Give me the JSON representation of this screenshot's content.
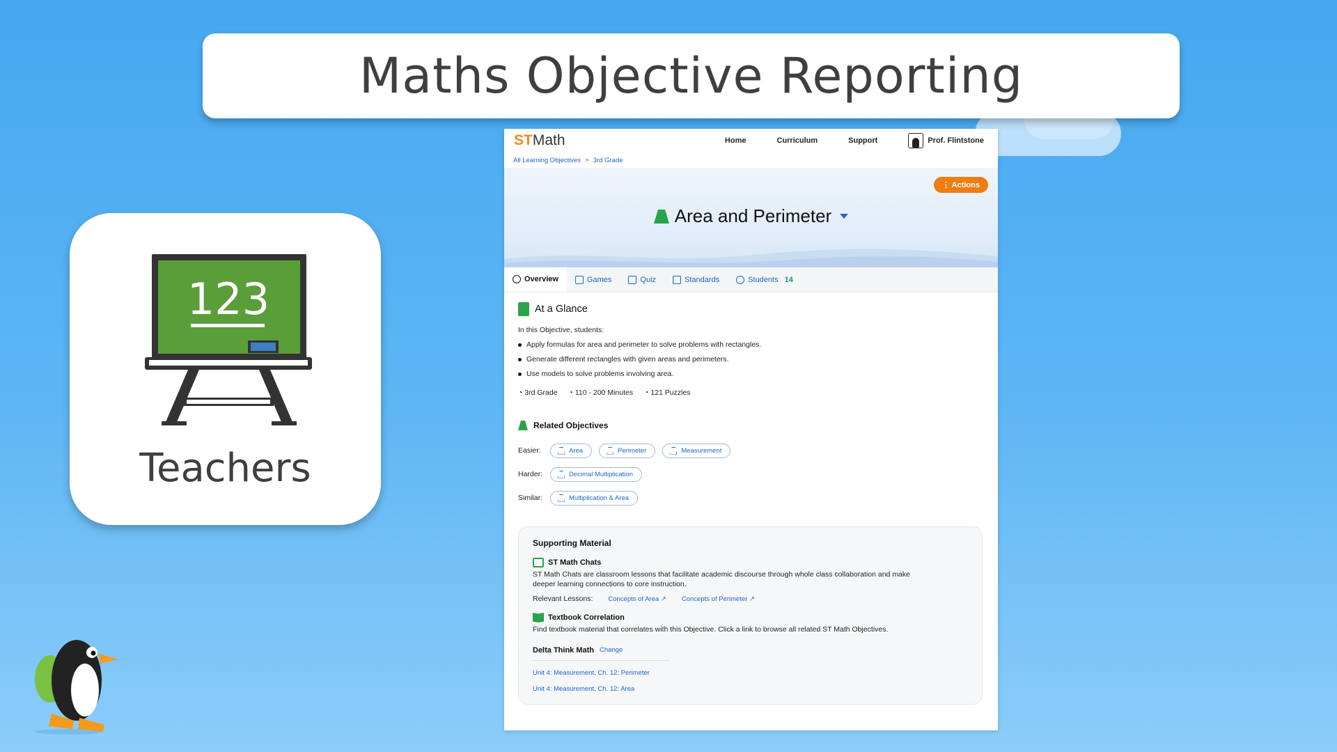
{
  "slide": {
    "title": "Maths Objective Reporting",
    "teachers_label": "Teachers",
    "board_number": "123"
  },
  "app": {
    "logo_st": "ST",
    "logo_math": "Math",
    "nav": {
      "home": "Home",
      "curriculum": "Curriculum",
      "support": "Support",
      "user": "Prof. Flintstone"
    },
    "breadcrumb": {
      "root": "All Learning Objectives",
      "separator": ">",
      "current": "3rd Grade"
    },
    "actions_label": "Actions",
    "objective_title": "Area and Perimeter",
    "tabs": [
      {
        "label": "Overview"
      },
      {
        "label": "Games"
      },
      {
        "label": "Quiz"
      },
      {
        "label": "Standards"
      },
      {
        "label": "Students",
        "count": "14"
      }
    ],
    "glance": {
      "title": "At a Glance",
      "intro": "In this Objective, students:",
      "bullets": [
        "Apply formulas for area and perimeter to solve problems with rectangles.",
        "Generate different rectangles with given areas and perimeters.",
        "Use models to solve problems involving area."
      ],
      "grade": "3rd Grade",
      "minutes": "110 - 200 Minutes",
      "puzzles": "121 Puzzles"
    },
    "related": {
      "title": "Related Objectives",
      "easier_label": "Easier:",
      "easier": [
        "Area",
        "Perimeter",
        "Measurement"
      ],
      "harder_label": "Harder:",
      "harder": [
        "Decimal Multiplication"
      ],
      "similar_label": "Similar:",
      "similar": [
        "Multiplication & Area"
      ]
    },
    "supporting": {
      "title": "Supporting Material",
      "chats_title": "ST Math Chats",
      "chats_desc": "ST Math Chats are classroom lessons that facilitate academic discourse through whole class collaboration and make deeper learning connections to core instruction.",
      "relevant_label": "Relevant Lessons:",
      "lessons": [
        "Concepts of Area",
        "Concepts of Perimeter"
      ],
      "textbook_title": "Textbook Correlation",
      "textbook_desc": "Find textbook material that correlates with this Objective.  Click a link to browse all related ST Math Objectives.",
      "textbook_name": "Delta Think Math",
      "change_label": "Change",
      "units": [
        "Unit 4: Measurement, Ch. 12: Perimeter",
        "Unit 4: Measurement, Ch. 12: Area"
      ]
    }
  },
  "colors": {
    "accent": "#ef7d12",
    "link": "#1b66c9",
    "green": "#2aa34a",
    "sky": "#45a8f0"
  }
}
